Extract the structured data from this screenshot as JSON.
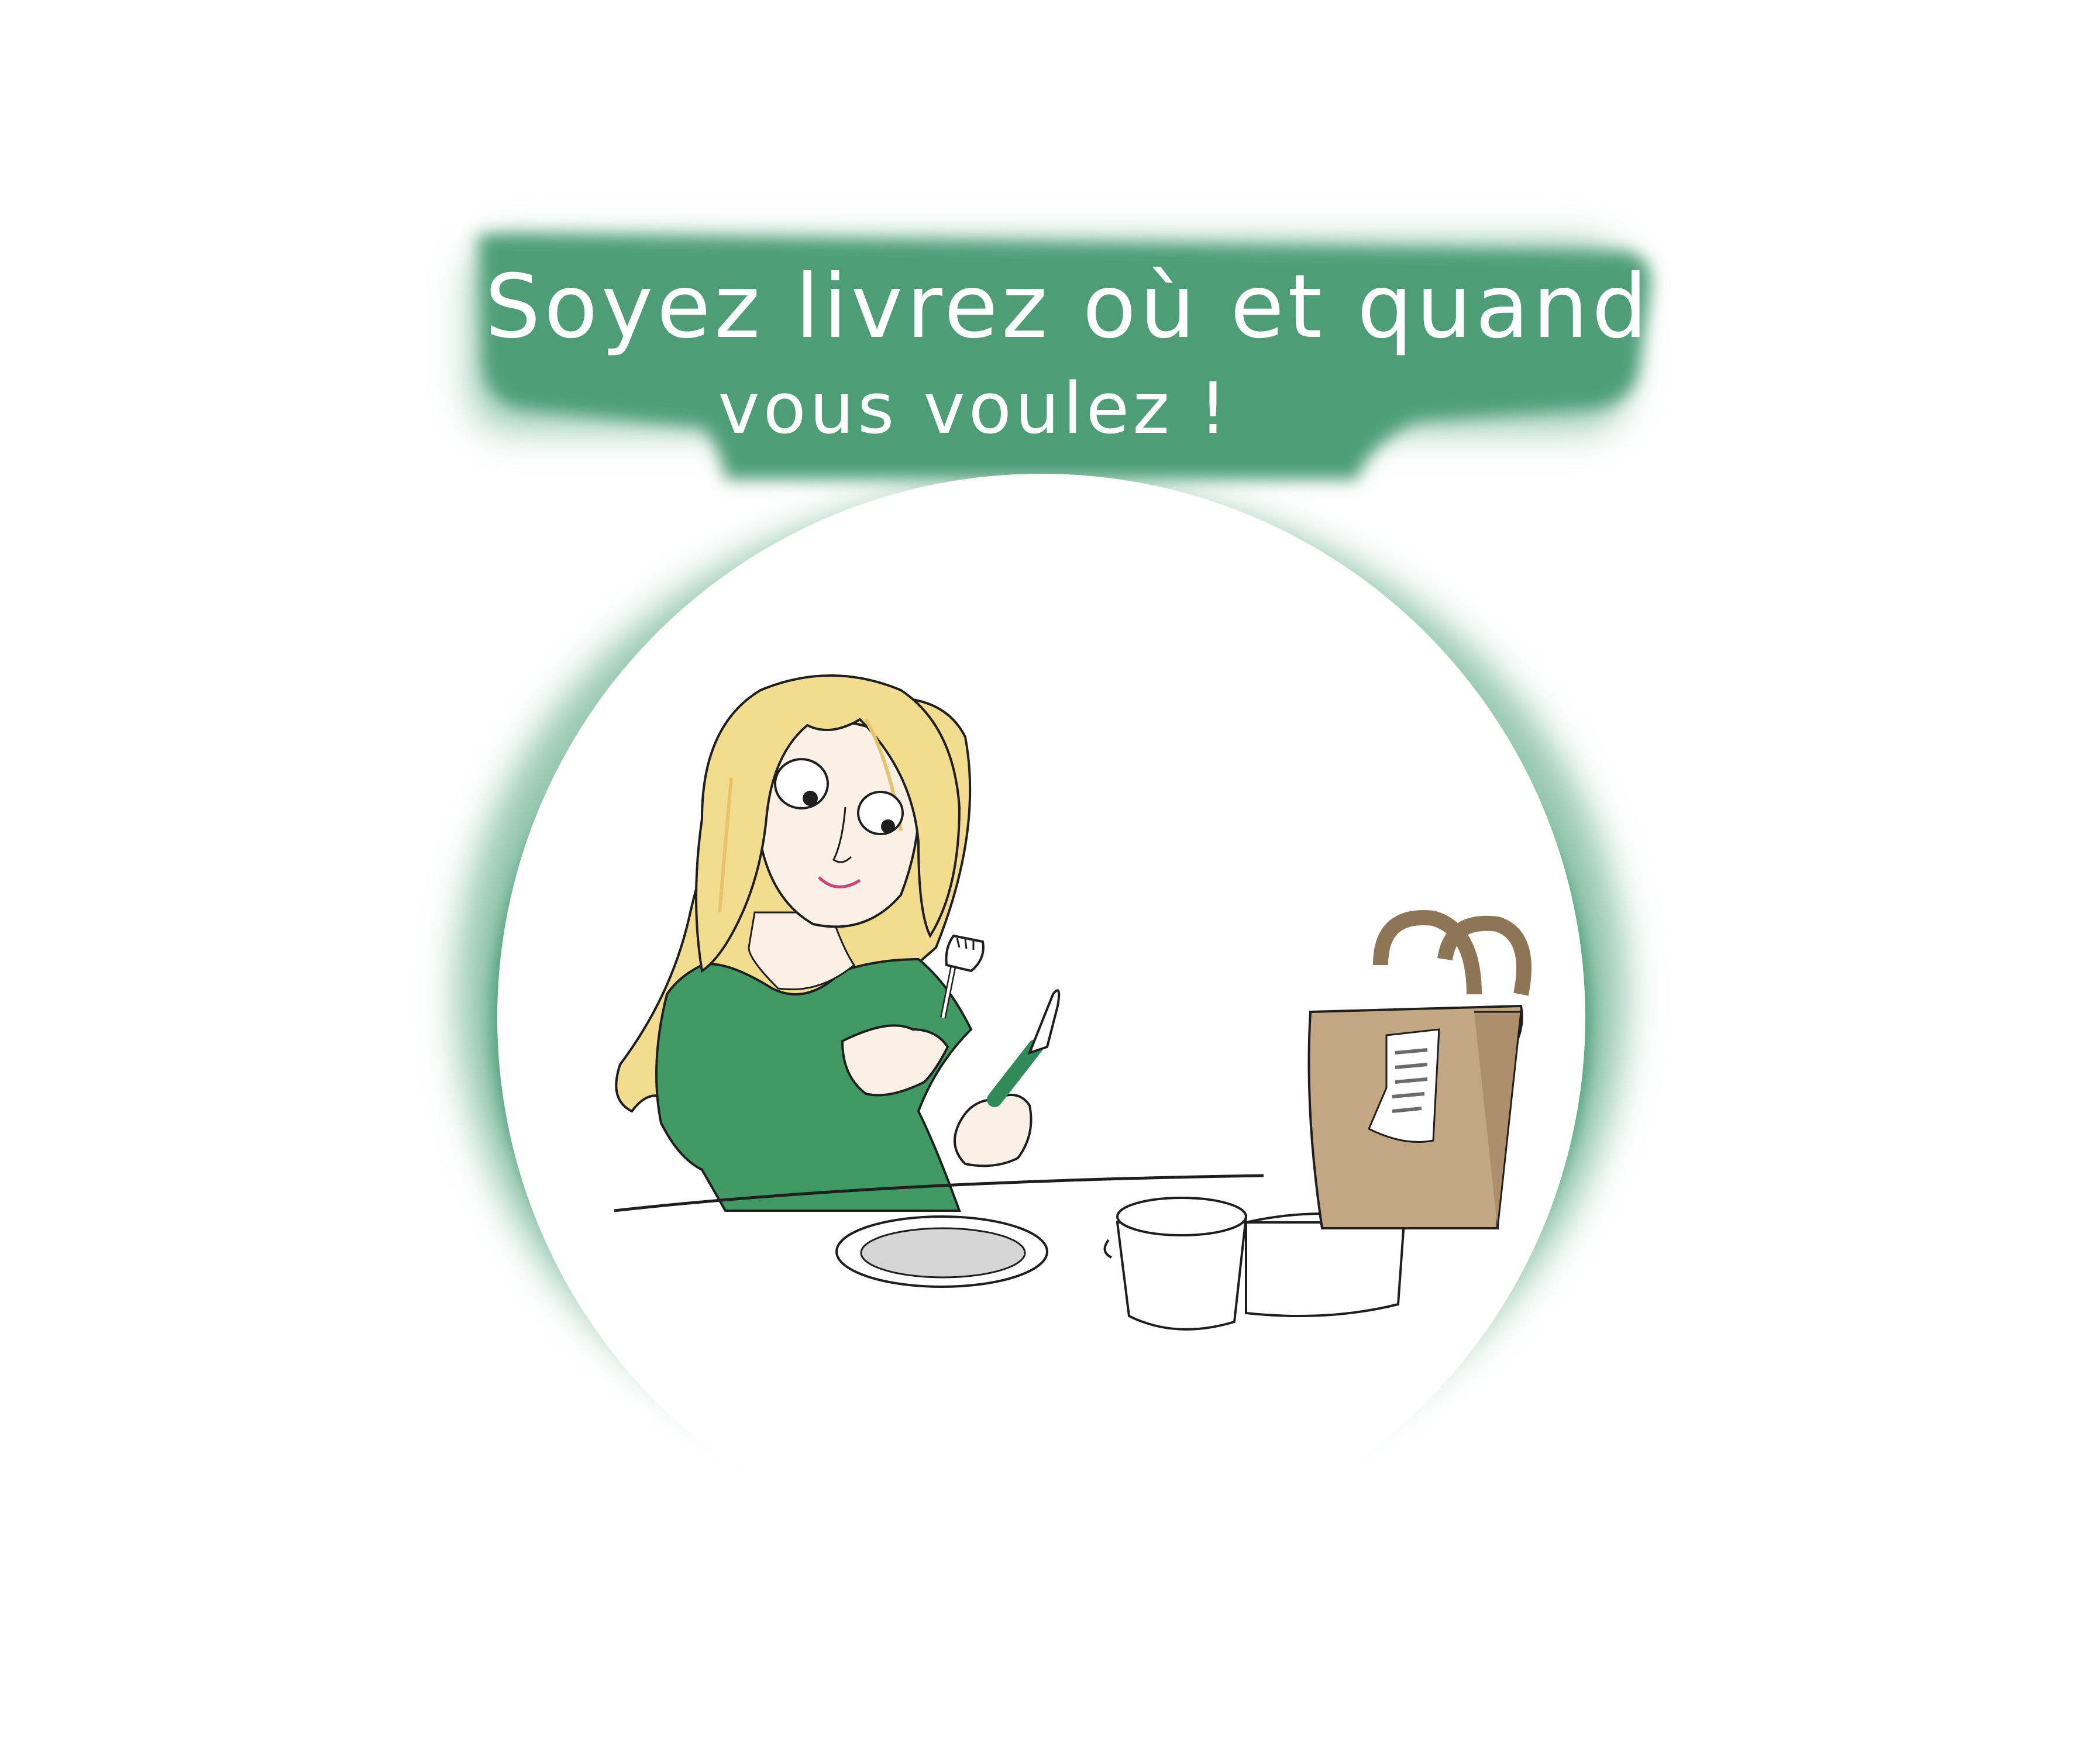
{
  "banner": {
    "line1": "Soyez livrez où et quand",
    "line2": "vous voulez !"
  },
  "colors": {
    "frame_green": "#4E9E77",
    "frame_green_light": "#86C0A3",
    "hair": "#F2DC8E",
    "hair_shade": "#E7C46A",
    "skin": "#FAF0E6",
    "shirt": "#3F9962",
    "bag": "#C3A783",
    "ink": "#1E1E1E"
  },
  "icons": {
    "fork": "fork-icon",
    "knife": "knife-icon",
    "plate": "plate-icon",
    "bag": "paper-bag-icon",
    "receipt": "receipt-icon",
    "jar": "jar-icon",
    "box": "food-box-icon"
  }
}
